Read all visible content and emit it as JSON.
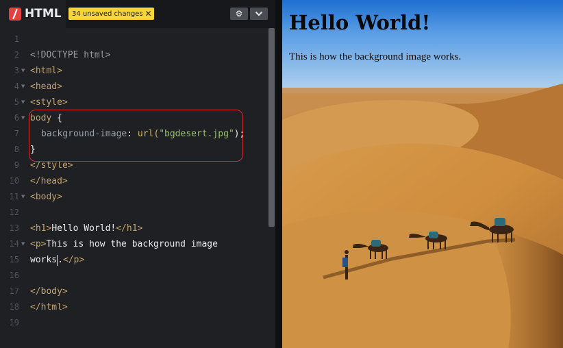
{
  "editor": {
    "language": "HTML",
    "unsaved_badge": "34 unsaved changes",
    "unsaved_close_icon": "close-icon",
    "settings_icon": "gear-icon",
    "collapse_icon": "chevron-down-icon",
    "line_numbers": [
      "1",
      "2",
      "3",
      "4",
      "5",
      "6",
      "7",
      "8",
      "9",
      "10",
      "11",
      "12",
      "13",
      "14",
      "15",
      "16",
      "17",
      "18",
      "19"
    ],
    "code": {
      "l2": "<!DOCTYPE html>",
      "l3": "<html>",
      "l4": "<head>",
      "l5": "<style>",
      "l6_sel": "body",
      "l6_brace": " {",
      "l7_prop": "background-image",
      "l7_colon": ": ",
      "l7_fn": "url(",
      "l7_str": "\"bgdesert.jpg\"",
      "l7_end": ");",
      "l8": "}",
      "l9": "</style>",
      "l10": "</head>",
      "l11": "<body>",
      "l13_open": "<h1>",
      "l13_text": "Hello World!",
      "l13_close": "</h1>",
      "l14_open": "<p>",
      "l14_text": "This is how the background image",
      "l14b_text": "works",
      "l14b_dot": ".",
      "l14b_close": "</p>",
      "l16": "</body>",
      "l17": "</html>"
    },
    "colors": {
      "tag": "#c3a26a",
      "string": "#9cc276",
      "badge": "#f6d53b",
      "highlight_border": "#d42b2b"
    }
  },
  "preview": {
    "heading": "Hello World!",
    "paragraph": "This is how the background image works."
  }
}
